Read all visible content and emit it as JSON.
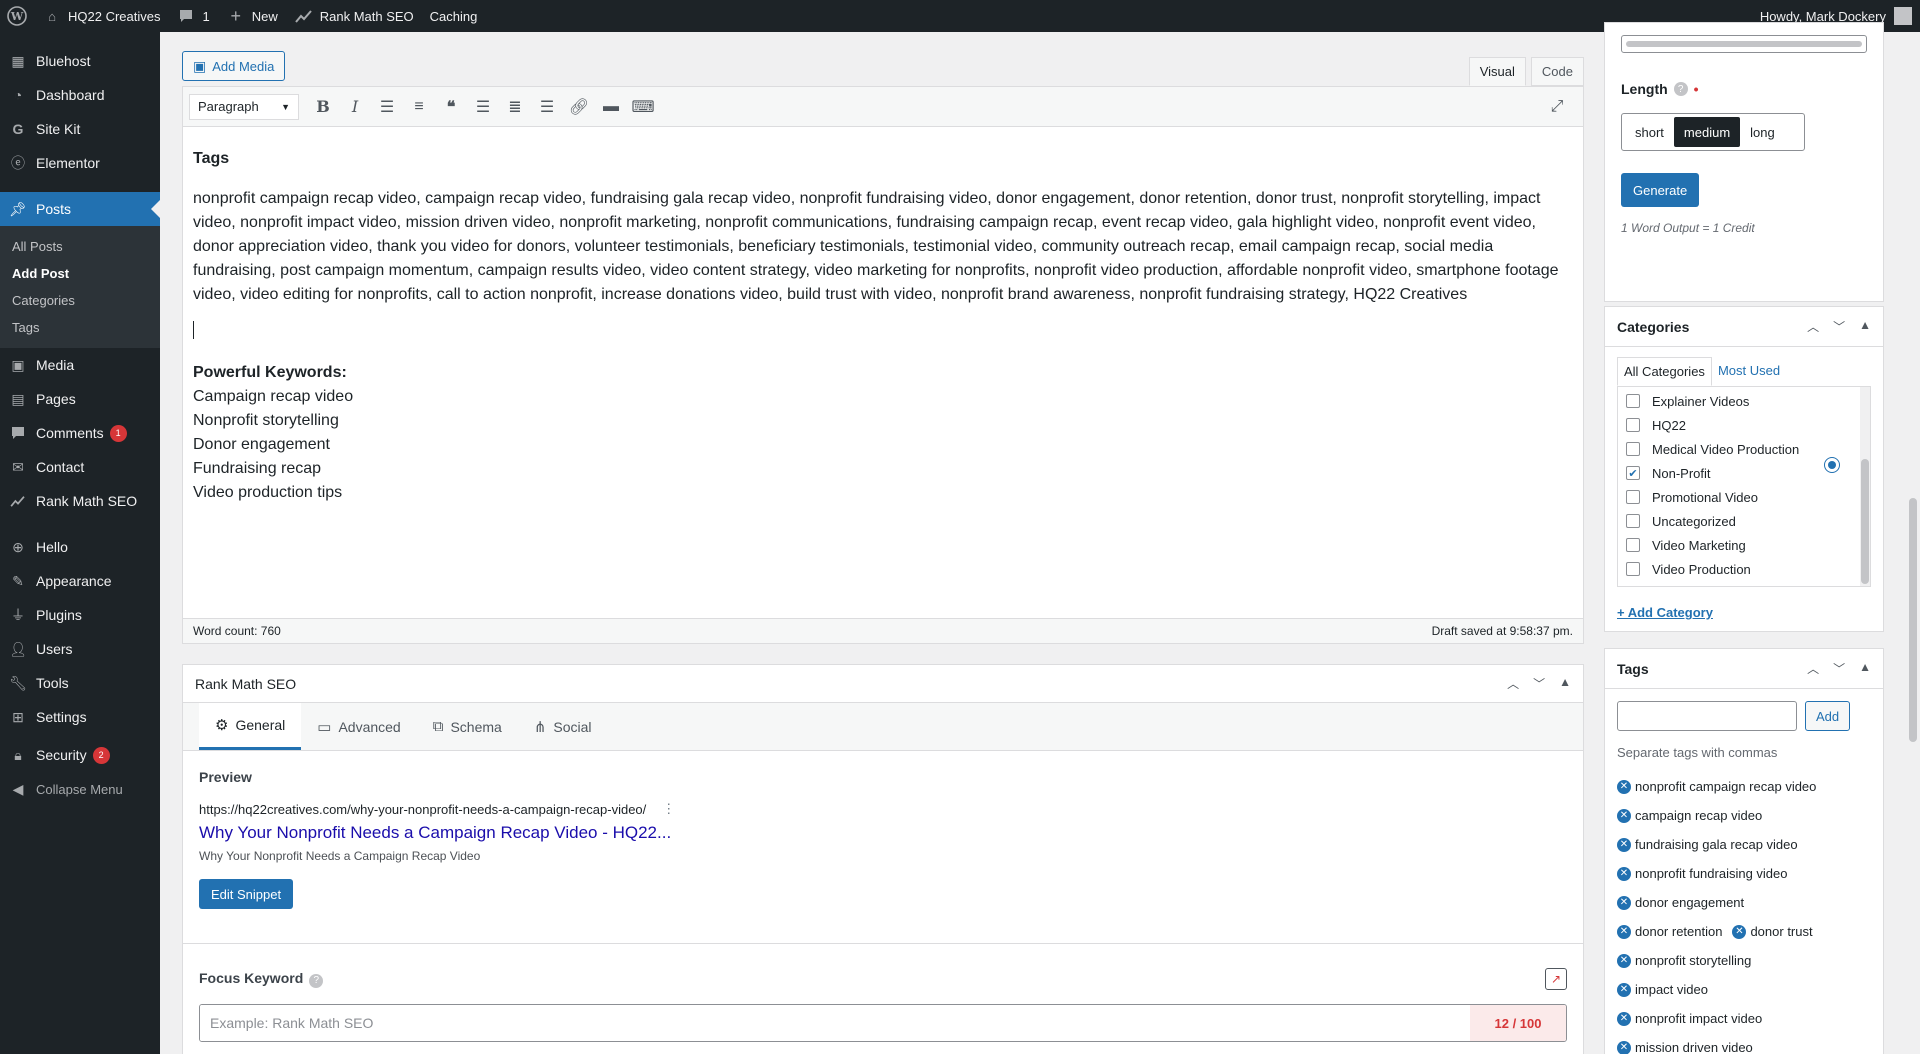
{
  "adminbar": {
    "site_name": "HQ22 Creatives",
    "comments_count": "1",
    "new_label": "New",
    "rankmath_label": "Rank Math SEO",
    "caching_label": "Caching",
    "howdy": "Howdy, Mark Dockery"
  },
  "sidebar": {
    "bluehost": "Bluehost",
    "dashboard": "Dashboard",
    "sitekit": "Site Kit",
    "elementor": "Elementor",
    "posts": "Posts",
    "sub": [
      "All Posts",
      "Add Post",
      "Categories",
      "Tags"
    ],
    "media": "Media",
    "pages": "Pages",
    "comments": "Comments",
    "comments_badge": "1",
    "contact": "Contact",
    "rankmath": "Rank Math SEO",
    "hello": "Hello",
    "appearance": "Appearance",
    "plugins": "Plugins",
    "users": "Users",
    "tools": "Tools",
    "settings": "Settings",
    "security": "Security",
    "security_badge": "2",
    "collapse": "Collapse Menu"
  },
  "editor": {
    "add_media": "Add Media",
    "tab_visual": "Visual",
    "tab_code": "Code",
    "format_value": "Paragraph",
    "heading": "Tags",
    "tags_paragraph": "nonprofit campaign recap video, campaign recap video, fundraising gala recap video, nonprofit fundraising video, donor engagement, donor retention, donor trust, nonprofit storytelling, impact video, nonprofit impact video, mission driven video, nonprofit marketing, nonprofit communications, fundraising campaign recap, event recap video, gala highlight video, nonprofit event video, donor appreciation video, thank you video for donors, volunteer testimonials, beneficiary testimonials, testimonial video, community outreach recap, email campaign recap, social media fundraising, post campaign momentum, campaign results video, video content strategy, video marketing for nonprofits, nonprofit video production, affordable nonprofit video, smartphone footage video, video editing for nonprofits, call to action nonprofit, increase donations video, build trust with video, nonprofit brand awareness, nonprofit fundraising strategy, HQ22 Creatives",
    "keywords_heading": "Powerful Keywords:",
    "keywords": [
      "Campaign recap video",
      "Nonprofit storytelling",
      "Donor engagement",
      "Fundraising recap",
      "Video production tips"
    ],
    "word_count": "Word count: 760",
    "draft_saved": "Draft saved at 9:58:37 pm."
  },
  "rankmath": {
    "title": "Rank Math SEO",
    "tabs": [
      "General",
      "Advanced",
      "Schema",
      "Social"
    ],
    "preview_label": "Preview",
    "url": "https://hq22creatives.com/why-your-nonprofit-needs-a-campaign-recap-video/",
    "snippet_title": "Why Your Nonprofit Needs a Campaign Recap Video - HQ22...",
    "snippet_desc": "Why Your Nonprofit Needs a Campaign Recap Video",
    "edit_snippet": "Edit Snippet",
    "focus_label": "Focus Keyword",
    "focus_placeholder": "Example: Rank Math SEO",
    "score": "12 / 100"
  },
  "side": {
    "length_label": "Length",
    "length_options": [
      "short",
      "medium",
      "long"
    ],
    "generate": "Generate",
    "credit": "1 Word Output = 1 Credit",
    "categories_title": "Categories",
    "cat_tab_all": "All Categories",
    "cat_tab_used": "Most Used",
    "categories": [
      {
        "name": "Explainer Videos",
        "checked": false
      },
      {
        "name": "HQ22",
        "checked": false
      },
      {
        "name": "Medical Video Production",
        "checked": false
      },
      {
        "name": "Non-Profit",
        "checked": true
      },
      {
        "name": "Promotional Video",
        "checked": false
      },
      {
        "name": "Uncategorized",
        "checked": false
      },
      {
        "name": "Video Marketing",
        "checked": false
      },
      {
        "name": "Video Production",
        "checked": false
      }
    ],
    "add_category": "+ Add Category",
    "tags_title": "Tags",
    "add_tag": "Add",
    "tags_hint": "Separate tags with commas",
    "tags": [
      "nonprofit campaign recap video",
      "campaign recap video",
      "fundraising gala recap video",
      "nonprofit fundraising video",
      "donor engagement",
      "donor retention",
      "donor trust",
      "nonprofit storytelling",
      "impact video",
      "nonprofit impact video",
      "mission driven video"
    ]
  }
}
